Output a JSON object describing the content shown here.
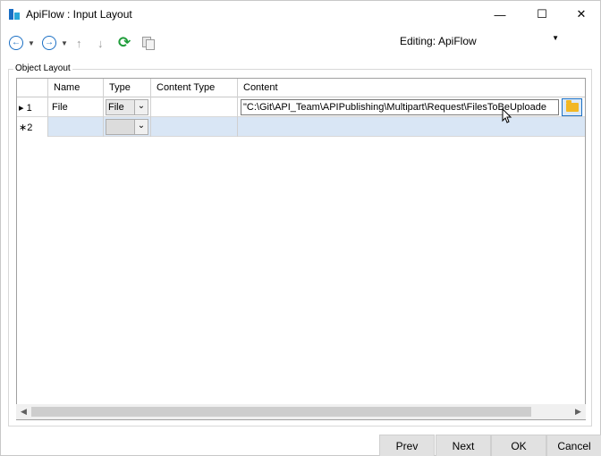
{
  "window": {
    "title": "ApiFlow : Input Layout",
    "minimize_glyph": "—",
    "maximize_glyph": "☐",
    "close_glyph": "✕"
  },
  "toolbar": {
    "back_glyph": "←",
    "forward_glyph": "→",
    "dropdown_glyph": "▼",
    "move_up_glyph": "↑",
    "move_down_glyph": "↓",
    "refresh_glyph": "⟳",
    "editing_label": "Editing:",
    "editing_value": "ApiFlow"
  },
  "group": {
    "label": "Object Layout"
  },
  "grid": {
    "columns": [
      "Name",
      "Type",
      "Content Type",
      "Content"
    ],
    "rows": [
      {
        "marker": "▸ 1",
        "name": "File",
        "type": "File",
        "content_type": "",
        "content": "\"C:\\Git\\API_Team\\APIPublishing\\Multipart\\Request\\FilesToBeUploade"
      },
      {
        "marker": "∗2",
        "name": "",
        "type": "",
        "content_type": "",
        "content": ""
      }
    ],
    "combo_glyph": "⌄",
    "scroll_left_glyph": "◀",
    "scroll_right_glyph": "▶"
  },
  "footer": {
    "prev": "Prev",
    "next": "Next",
    "ok": "OK",
    "cancel": "Cancel"
  },
  "colors": {
    "accent": "#1a6fc4",
    "selected_row": "#d9e6f5",
    "folder": "#f2b723"
  }
}
